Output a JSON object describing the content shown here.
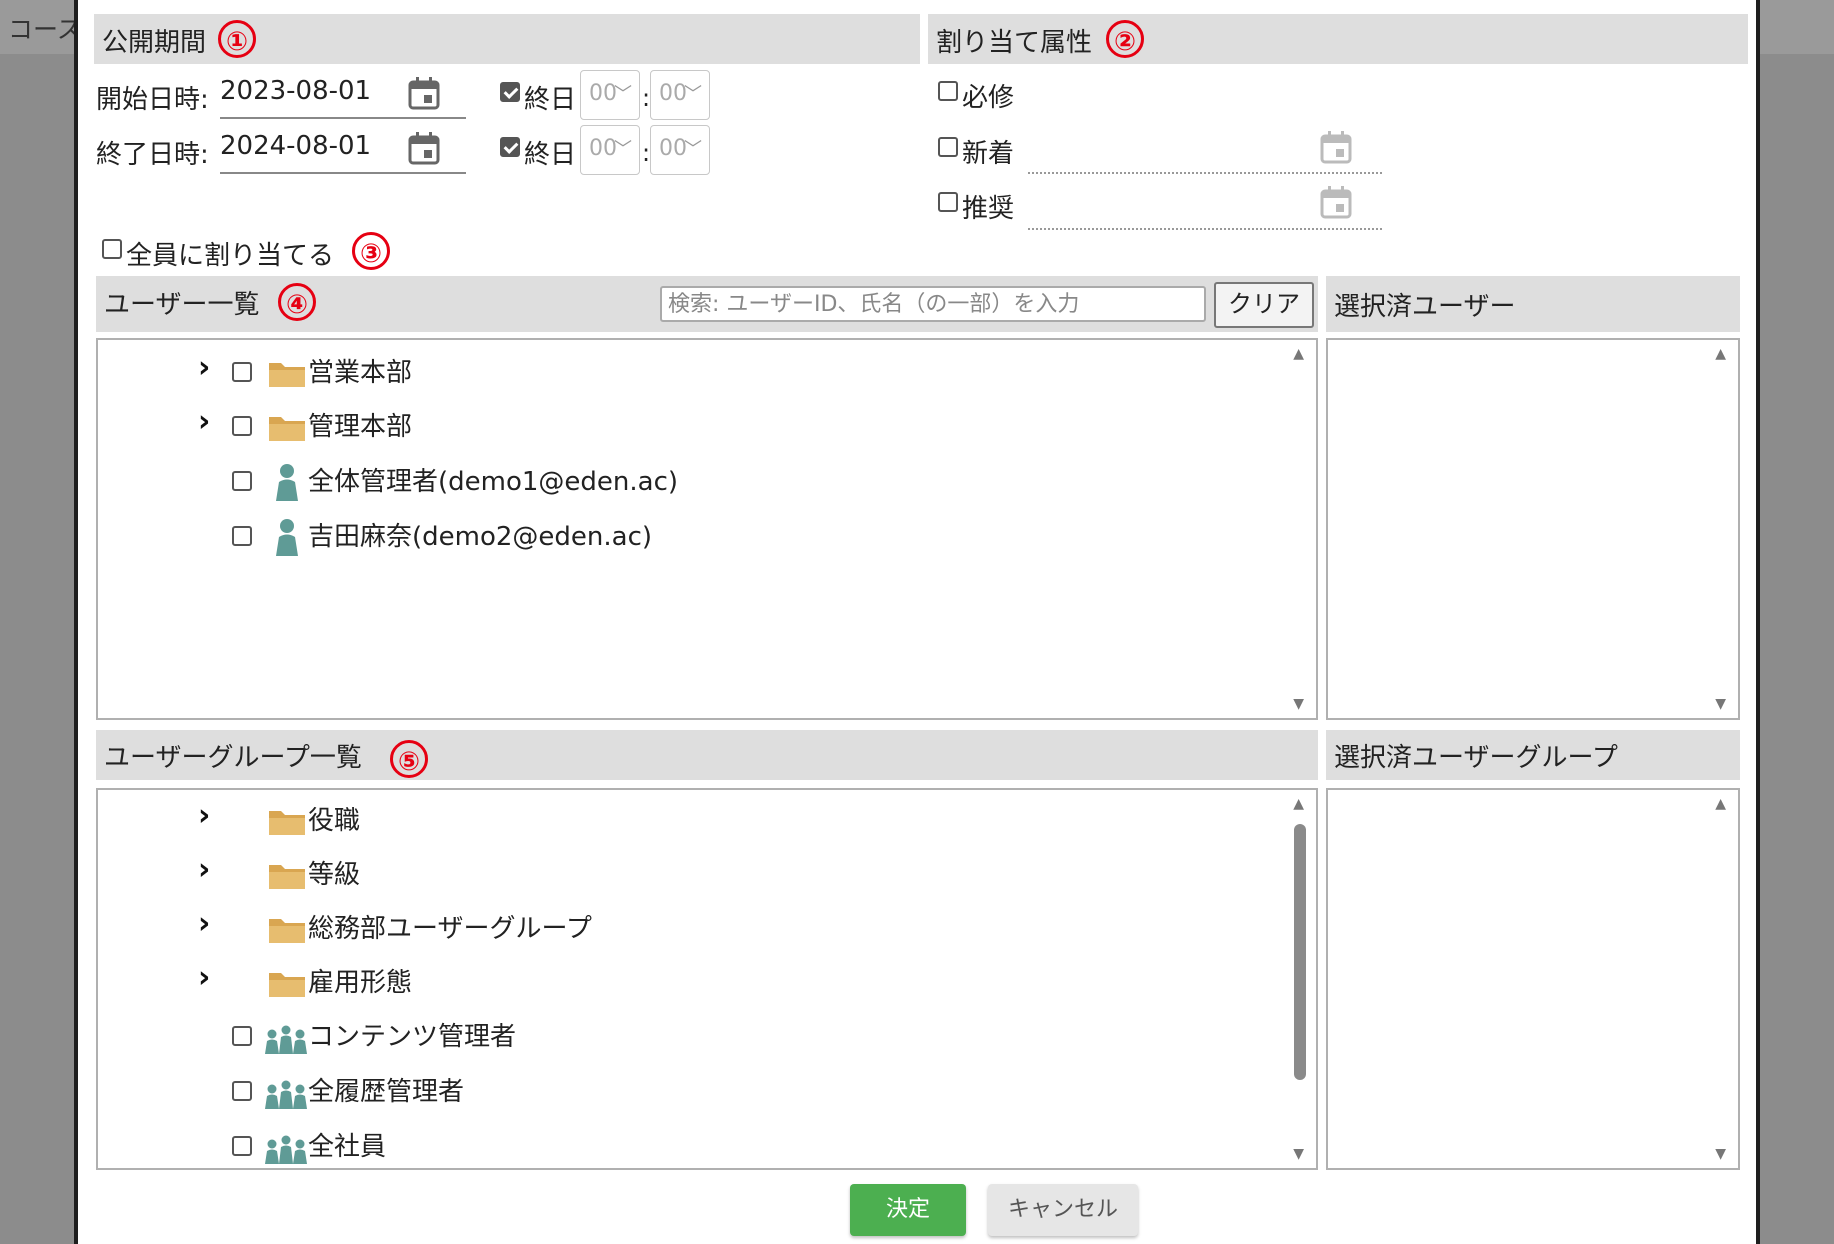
{
  "background": {
    "title_fragment": "コース"
  },
  "period": {
    "header": "公開期間",
    "marker": "①",
    "start": {
      "label": "開始日時:",
      "date": "2023-08-01",
      "allday_label": "終日",
      "allday_checked": true,
      "hour": "00",
      "minute": "00"
    },
    "end": {
      "label": "終了日時:",
      "date": "2024-08-01",
      "allday_label": "終日",
      "allday_checked": true,
      "hour": "00",
      "minute": "00"
    },
    "colon": ":"
  },
  "attributes": {
    "header": "割り当て属性",
    "marker": "②",
    "items": [
      {
        "label": "必修",
        "checked": false
      },
      {
        "label": "新着",
        "checked": false
      },
      {
        "label": "推奨",
        "checked": false
      }
    ]
  },
  "assign_all": {
    "label": "全員に割り当てる",
    "marker": "③",
    "checked": false
  },
  "users": {
    "header": "ユーザー一覧",
    "marker": "④",
    "search_placeholder": "検索: ユーザーID、氏名（の一部）を入力",
    "clear_label": "クリア",
    "selected_header": "選択済ユーザー",
    "tree": [
      {
        "type": "folder",
        "label": "営業本部"
      },
      {
        "type": "folder",
        "label": "管理本部"
      },
      {
        "type": "user",
        "label": "全体管理者(demo1@eden.ac)"
      },
      {
        "type": "user",
        "label": "吉田麻奈(demo2@eden.ac)"
      }
    ]
  },
  "groups": {
    "header": "ユーザーグループ一覧",
    "marker": "⑤",
    "selected_header": "選択済ユーザーグループ",
    "tree": [
      {
        "type": "folder",
        "label": "役職"
      },
      {
        "type": "folder",
        "label": "等級"
      },
      {
        "type": "folder",
        "label": "総務部ユーザーグループ"
      },
      {
        "type": "folder",
        "label": "雇用形態"
      },
      {
        "type": "group",
        "label": "コンテンツ管理者"
      },
      {
        "type": "group",
        "label": "全履歴管理者"
      },
      {
        "type": "group",
        "label": "全社員"
      }
    ]
  },
  "footer": {
    "ok_label": "決定",
    "cancel_label": "キャンセル"
  },
  "colors": {
    "accent_red": "#e60012",
    "ok_green": "#4caf50",
    "folder": "#e7bd6f",
    "person": "#5f9b96"
  }
}
